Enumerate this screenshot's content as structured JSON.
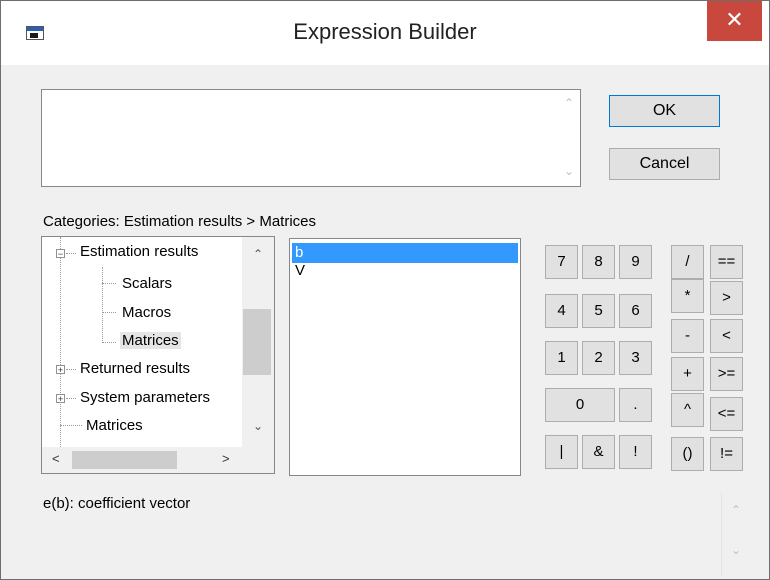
{
  "window": {
    "title": "Expression Builder",
    "close_symbol": "✕"
  },
  "expression": {
    "value": ""
  },
  "buttons": {
    "ok_label": "OK",
    "cancel_label": "Cancel"
  },
  "categories_label": "Categories: Estimation results > Matrices",
  "tree": {
    "items": [
      {
        "label": "Estimation results",
        "expanded": true
      },
      {
        "label": "Scalars"
      },
      {
        "label": "Macros"
      },
      {
        "label": "Matrices",
        "selected": true
      },
      {
        "label": "Returned results",
        "expanded": false
      },
      {
        "label": "System parameters",
        "expanded": false
      },
      {
        "label": "Matrices"
      }
    ]
  },
  "list": {
    "items": [
      "b",
      "V"
    ],
    "selected_index": 0
  },
  "keypad": {
    "digits": [
      "7",
      "8",
      "9",
      "4",
      "5",
      "6",
      "1",
      "2",
      "3",
      "0",
      "."
    ],
    "operators": [
      "/",
      "==",
      "*",
      ">",
      "-",
      "<",
      "+",
      ">=",
      "^",
      "<=",
      "()",
      "!="
    ],
    "logical": [
      "|",
      "&",
      "!"
    ]
  },
  "description": "e(b):  coefficient vector",
  "icons": {
    "scroll_up": "▲",
    "scroll_down": "▼",
    "scroll_left": "◀",
    "scroll_right": "▶",
    "chevron_up": "⌃",
    "chevron_down": "⌄",
    "chevron_left": "<",
    "chevron_right": ">",
    "expanded": "−",
    "collapsed": "+"
  }
}
